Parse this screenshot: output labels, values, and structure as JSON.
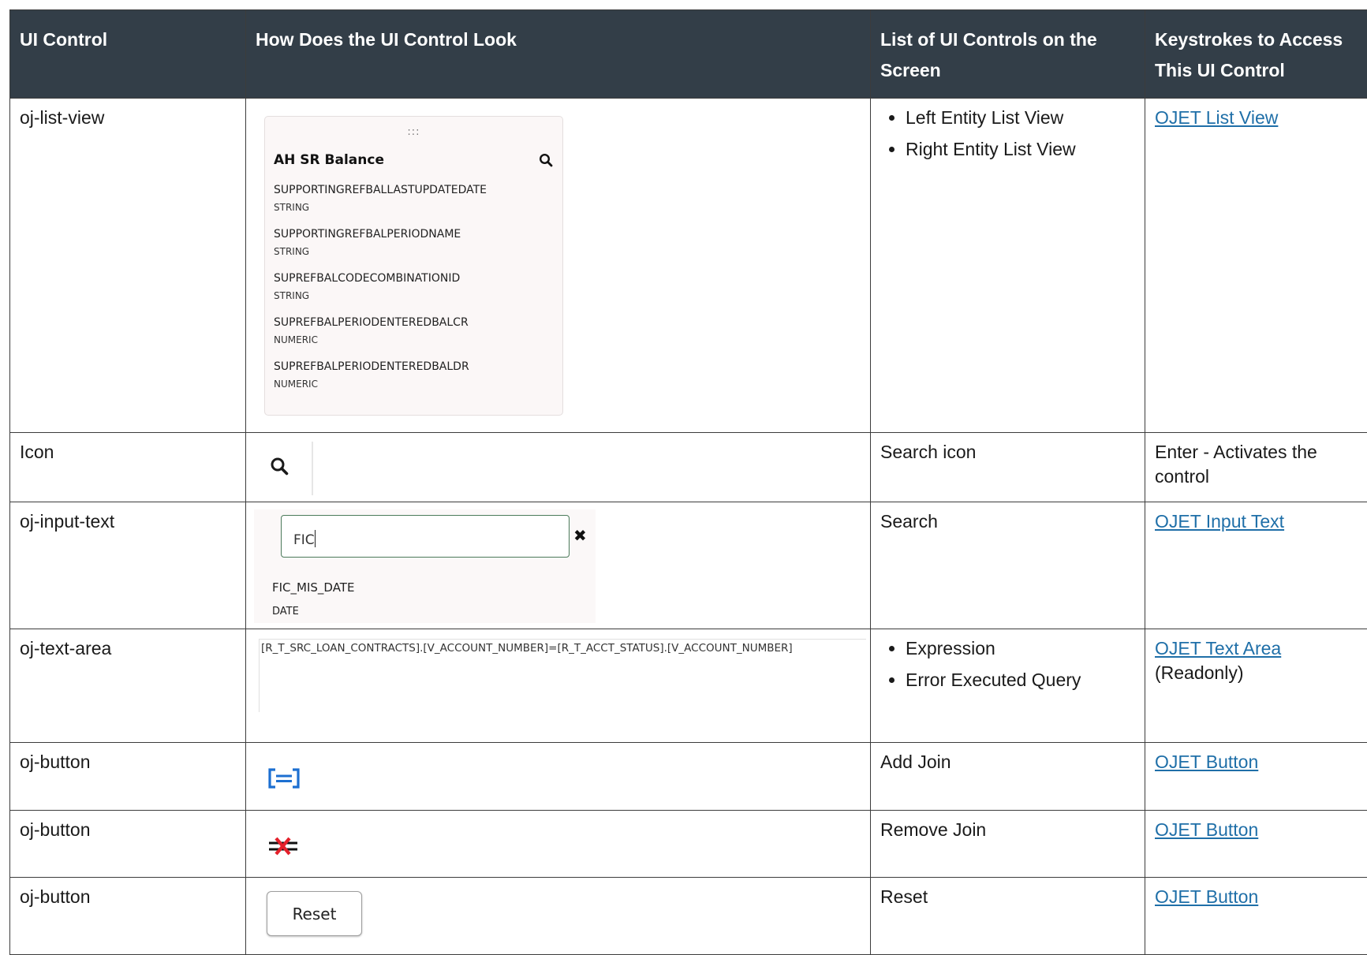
{
  "header": {
    "col1": "UI Control",
    "col2": "How Does the UI Control Look",
    "col3": "List of UI Controls on the Screen",
    "col4": "Keystrokes to Access This UI Control"
  },
  "rows": [
    {
      "control": "oj-list-view",
      "controls_on_screen": [
        "Left Entity List View",
        "Right Entity List View"
      ],
      "keystroke_link": "OJET List View",
      "preview": {
        "handle": ":::",
        "title": "AH SR Balance",
        "items": [
          {
            "name": "SUPPORTINGREFBALLASTUPDATEDATE",
            "type": "STRING"
          },
          {
            "name": "SUPPORTINGREFBALPERIODNAME",
            "type": "STRING"
          },
          {
            "name": "SUPREFBALCODECOMBINATIONID",
            "type": "STRING"
          },
          {
            "name": "SUPREFBALPERIODENTEREDBALCR",
            "type": "NUMERIC"
          },
          {
            "name": "SUPREFBALPERIODENTEREDBALDR",
            "type": "NUMERIC"
          }
        ]
      }
    },
    {
      "control": "Icon",
      "controls_on_screen": [
        "Search icon"
      ],
      "keystroke_text": "Enter - Activates the control",
      "preview": {
        "icon": "search-icon"
      }
    },
    {
      "control": "oj-input-text",
      "controls_on_screen": [
        "Search"
      ],
      "keystroke_link": "OJET Input Text",
      "preview": {
        "value": "FIC",
        "clear_glyph": "✖",
        "result_name": "FIC_MIS_DATE",
        "result_type": "DATE"
      }
    },
    {
      "control": "oj-text-area",
      "controls_on_screen": [
        "Expression",
        "Error Executed Query"
      ],
      "keystroke_link": "OJET Text Area",
      "keystroke_note": "(Readonly)",
      "preview": {
        "text": "[R_T_SRC_LOAN_CONTRACTS].[V_ACCOUNT_NUMBER]=[R_T_ACCT_STATUS].[V_ACCOUNT_NUMBER]"
      }
    },
    {
      "control": "oj-button",
      "controls_on_screen": [
        "Add Join"
      ],
      "keystroke_link": "OJET Button",
      "preview": {
        "icon": "add-join-icon",
        "color": "#1c6fd1"
      }
    },
    {
      "control": "oj-button",
      "controls_on_screen": [
        "Remove Join"
      ],
      "keystroke_link": "OJET Button",
      "preview": {
        "icon": "remove-join-icon",
        "color": "#e4202a"
      }
    },
    {
      "control": "oj-button",
      "controls_on_screen": [
        "Reset"
      ],
      "keystroke_link": "OJET Button",
      "preview": {
        "button_label": "Reset"
      }
    }
  ],
  "colors": {
    "header_bg": "#333e48",
    "link": "#1f6fa8",
    "border": "#3c3c3c"
  }
}
